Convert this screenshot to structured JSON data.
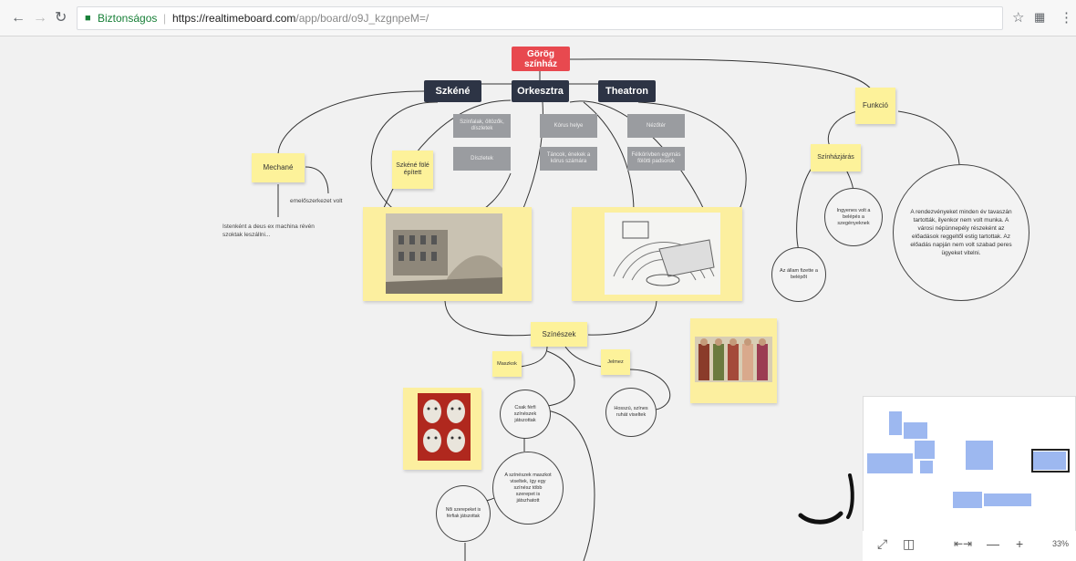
{
  "browser": {
    "back_icon": "back-arrow-icon",
    "forward_icon": "forward-arrow-icon",
    "reload_icon": "reload-icon",
    "secure_label": "Biztonságos",
    "url_host": "https://realtimeboard.com",
    "url_path": "/app/board/o9J_kzgnpeM=/",
    "star_icon": "star-icon",
    "extension_icon": "extension-icon",
    "menu_icon": "menu-kebab-icon"
  },
  "board": {
    "root_title": "Görög színház",
    "headers": [
      "Szkéné",
      "Orkesztra",
      "Theatron"
    ],
    "gray_cards": [
      "Színfalak, öltözők, díszletek",
      "Díszletek",
      "Kórus helye",
      "Táncok, énekek a kórus számára",
      "Nézőtér",
      "Félkörívben egymás fölötti padsorok"
    ],
    "sticky_left_note": "Szkéné fölé épített",
    "sticky_mechane": "Mechané",
    "mechane_label": "emelőszerkezet volt",
    "mechane_note": "Istenként a deus ex machina révén szoktak leszállni...",
    "sticky_funkcio": "Funkció",
    "sticky_szinhazjaro": "Színházjárás",
    "circle_big": "A rendezvényeket minden év tavaszán tartották, ilyenkor nem volt munka. A városi népünnepély részeként az előadások reggeltől estig tartottak. Az előadás napján nem volt szabad peres ügyeket vitelni.",
    "circle_mid": "Ingyenes volt a belépés a szegényeknek",
    "circle_small": "Az állam fizette a belépőt",
    "sticky_szineszek": "Színészek",
    "sticky_maszk": "Maszkok",
    "sticky_jelmez": "Jelmez",
    "circle_szin1": "Csak férfi színészek játszottak",
    "circle_szin2": "A színészek maszkot viseltek, így egy színész több szerepet is játszhatott",
    "circle_szin3": "Hosszú, színes ruhát viseltek",
    "circle_szin4": "Női szerepeket is férfiak játszottak"
  },
  "photos": {
    "theatre_ruins": "engraving of ancient theatre ruins",
    "theatre_plan": "drawing of greek theatre",
    "masks": "greek theatre masks",
    "actors": "actors in greek costumes"
  },
  "minimap": {
    "expand_icon": "fullscreen-expand-icon",
    "map_icon": "map-icon",
    "fit_icon": "fit-to-screen-icon",
    "zoom_out_label": "—",
    "zoom_in_label": "+",
    "zoom_level": "33%"
  },
  "colors": {
    "accent_red": "#e8494f",
    "header_dark": "#2d3445",
    "sticky_yellow": "#fdf29a",
    "minimap_blue": "#9db8f0"
  }
}
